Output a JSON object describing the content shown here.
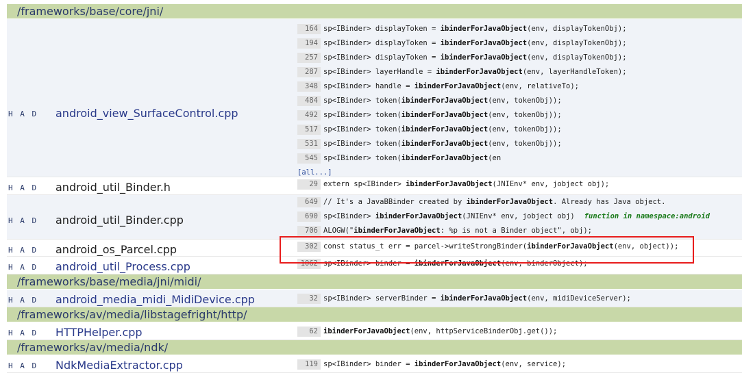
{
  "had": {
    "h": "H",
    "a": "A",
    "d": "D"
  },
  "more_link": "[all...]",
  "groups": [
    {
      "dir": "/frameworks/base/core/jni/",
      "files": [
        {
          "name": "android_view_SurfaceControl.cpp",
          "lines": [
            {
              "n": "164",
              "pre": "sp<IBinder> displayToken = ",
              "fn": "ibinderForJavaObject",
              "post": "(env, displayTokenObj);"
            },
            {
              "n": "194",
              "pre": "sp<IBinder> displayToken = ",
              "fn": "ibinderForJavaObject",
              "post": "(env, displayTokenObj);"
            },
            {
              "n": "257",
              "pre": "sp<IBinder> displayToken = ",
              "fn": "ibinderForJavaObject",
              "post": "(env, displayTokenObj);"
            },
            {
              "n": "287",
              "pre": "sp<IBinder> layerHandle = ",
              "fn": "ibinderForJavaObject",
              "post": "(env, layerHandleToken);"
            },
            {
              "n": "348",
              "pre": "sp<IBinder> handle = ",
              "fn": "ibinderForJavaObject",
              "post": "(env, relativeTo);"
            },
            {
              "n": "484",
              "pre": "sp<IBinder> token(",
              "fn": "ibinderForJavaObject",
              "post": "(env, tokenObj));"
            },
            {
              "n": "492",
              "pre": "sp<IBinder> token(",
              "fn": "ibinderForJavaObject",
              "post": "(env, tokenObj));"
            },
            {
              "n": "517",
              "pre": "sp<IBinder> token(",
              "fn": "ibinderForJavaObject",
              "post": "(env, tokenObj));"
            },
            {
              "n": "531",
              "pre": "sp<IBinder> token(",
              "fn": "ibinderForJavaObject",
              "post": "(env, tokenObj));"
            },
            {
              "n": "545",
              "pre": "sp<IBinder> token(",
              "fn": "ibinderForJavaObject",
              "post": "(en"
            }
          ],
          "has_more": true
        },
        {
          "name": "android_util_Binder.h",
          "lines": [
            {
              "n": "29",
              "pre": "extern sp<IBinder> ",
              "fn": "ibinderForJavaObject",
              "post": "(JNIEnv* env, jobject obj);"
            }
          ]
        },
        {
          "name": "android_util_Binder.cpp",
          "lines": [
            {
              "n": "649",
              "pre": "// It's a JavaBBinder created by ",
              "fn": "ibinderForJavaObject",
              "post": ". Already has Java object."
            },
            {
              "n": "690",
              "pre": "sp<IBinder> ",
              "fn": "ibinderForJavaObject",
              "post": "(JNIEnv* env, jobject obj)",
              "note": "function in namespace:android"
            },
            {
              "n": "706",
              "pre": "ALOGW(\"",
              "fn": "ibinderForJavaObject",
              "post": ": %p is not a Binder object\", obj);"
            }
          ]
        },
        {
          "name": "android_os_Parcel.cpp",
          "lines": [
            {
              "n": "302",
              "pre": "const status_t err = parcel->writeStrongBinder(",
              "fn": "ibinderForJavaObject",
              "post": "(env, object));"
            }
          ]
        },
        {
          "name": "android_util_Process.cpp",
          "lines": [
            {
              "n": "1062",
              "pre": "sp<IBinder> binder = ",
              "fn": "ibinderForJavaObject",
              "post": "(env, binderObject);"
            }
          ]
        }
      ]
    },
    {
      "dir": "/frameworks/base/media/jni/midi/",
      "files": [
        {
          "name": "android_media_midi_MidiDevice.cpp",
          "lines": [
            {
              "n": "32",
              "pre": "sp<IBinder> serverBinder = ",
              "fn": "ibinderForJavaObject",
              "post": "(env, midiDeviceServer);"
            }
          ]
        }
      ]
    },
    {
      "dir": "/frameworks/av/media/libstagefright/http/",
      "files": [
        {
          "name": "HTTPHelper.cpp",
          "lines": [
            {
              "n": "62",
              "pre": "",
              "fn": "ibinderForJavaObject",
              "post": "(env, httpServiceBinderObj.get());"
            }
          ]
        }
      ]
    },
    {
      "dir": "/frameworks/av/media/ndk/",
      "files": [
        {
          "name": "NdkMediaExtractor.cpp",
          "lines": [
            {
              "n": "119",
              "pre": "sp<IBinder> binder = ",
              "fn": "ibinderForJavaObject",
              "post": "(env, service);"
            }
          ]
        }
      ]
    }
  ],
  "colors": {
    "dir_bg": "#c8d8a8",
    "alt_row_bg": "#f0f3f8",
    "highlight_border": "#e81c1c",
    "link": "#2a3a8a",
    "note": "#1a7a1a"
  }
}
